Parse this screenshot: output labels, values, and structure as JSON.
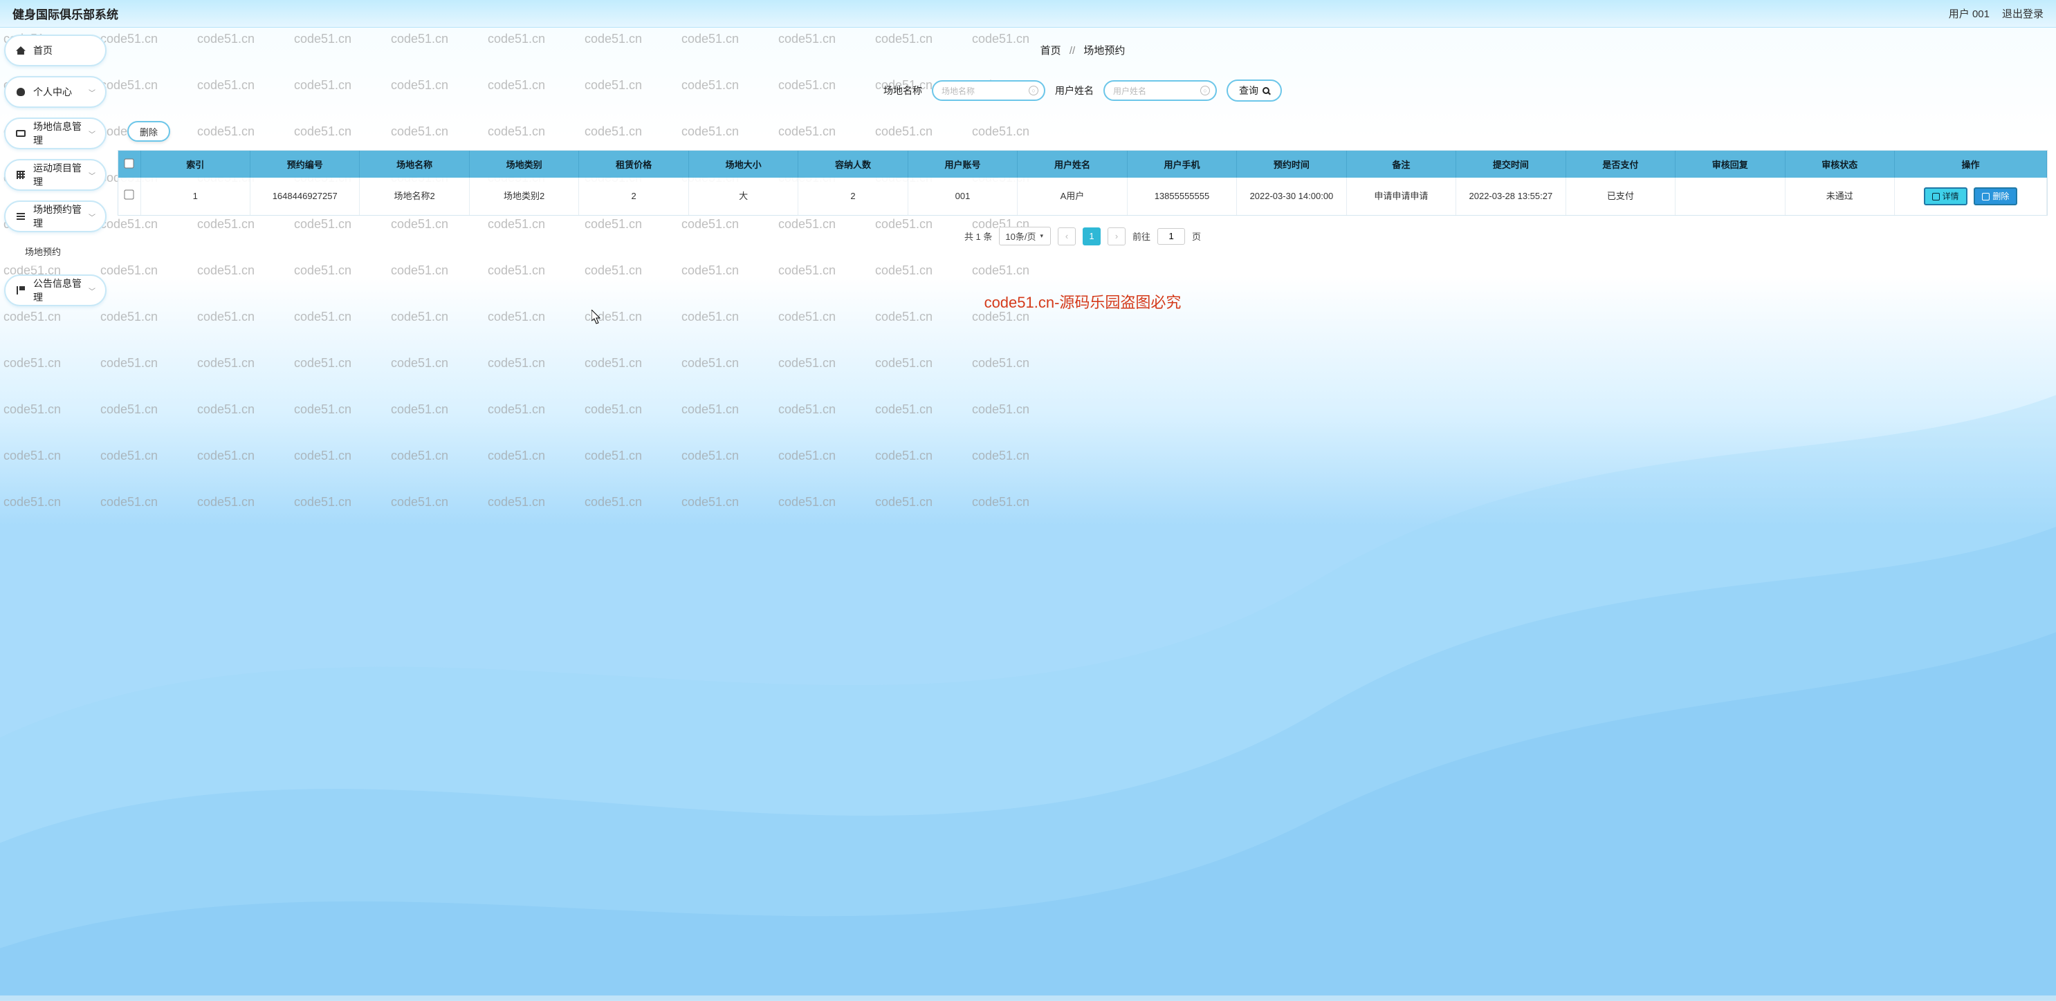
{
  "header": {
    "title": "健身国际俱乐部系统",
    "user_label": "用户 001",
    "logout_label": "退出登录"
  },
  "sidebar": {
    "items": [
      {
        "label": "首页",
        "icon": "home"
      },
      {
        "label": "个人中心",
        "icon": "user",
        "expandable": true
      },
      {
        "label": "场地信息管理",
        "icon": "monitor",
        "expandable": true
      },
      {
        "label": "运动项目管理",
        "icon": "grid",
        "expandable": true
      },
      {
        "label": "场地预约管理",
        "icon": "list",
        "expandable": true,
        "sub": [
          {
            "label": "场地预约"
          }
        ]
      },
      {
        "label": "公告信息管理",
        "icon": "flag",
        "expandable": true
      }
    ]
  },
  "breadcrumb": {
    "home": "首页",
    "sep": "//",
    "current": "场地预约"
  },
  "search": {
    "field1_label": "场地名称",
    "field1_placeholder": "场地名称",
    "field2_label": "用户姓名",
    "field2_placeholder": "用户姓名",
    "query_label": "查询"
  },
  "toolbar": {
    "delete_label": "删除"
  },
  "table": {
    "columns": [
      "索引",
      "预约编号",
      "场地名称",
      "场地类别",
      "租赁价格",
      "场地大小",
      "容纳人数",
      "用户账号",
      "用户姓名",
      "用户手机",
      "预约时间",
      "备注",
      "提交时间",
      "是否支付",
      "审核回复",
      "审核状态",
      "操作"
    ],
    "rows": [
      {
        "cells": [
          "1",
          "1648446927257",
          "场地名称2",
          "场地类别2",
          "2",
          "大",
          "2",
          "001",
          "A用户",
          "13855555555",
          "2022-03-30 14:00:00",
          "申请申请申请",
          "2022-03-28 13:55:27",
          "已支付",
          "",
          "未通过"
        ],
        "actions": {
          "detail": "详情",
          "delete": "删除"
        }
      }
    ]
  },
  "pager": {
    "total_text": "共 1 条",
    "page_size_text": "10条/页",
    "current_page": "1",
    "goto_prefix": "前往",
    "goto_value": "1",
    "goto_suffix": "页"
  },
  "watermark_text": "code51.cn",
  "center_mark": "code51.cn-源码乐园盗图必究"
}
